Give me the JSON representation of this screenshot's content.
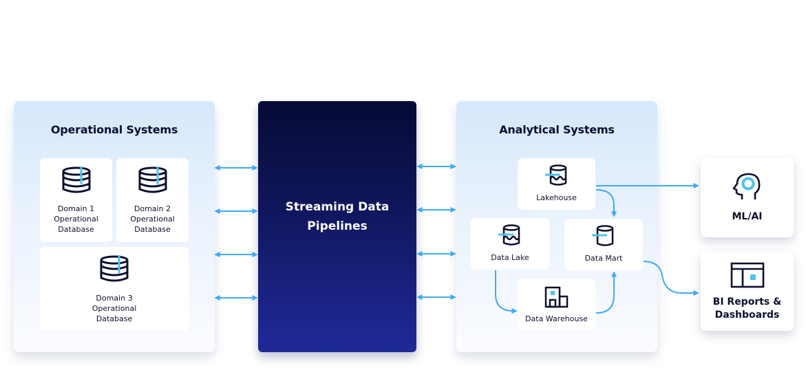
{
  "colors": {
    "accent": "#3fa9f5",
    "icon_stroke": "#0b0f2e",
    "icon_highlight": "#4dc3ee",
    "pipeline_top": "#050a35",
    "pipeline_bottom": "#1f2a9a",
    "panel_tint": "#d6e8fc"
  },
  "operational": {
    "title": "Operational Systems",
    "databases": [
      {
        "line1": "Domain 1",
        "line2": "Operational",
        "line3": "Database",
        "icon": "database-icon"
      },
      {
        "line1": "Domain 2",
        "line2": "Operational",
        "line3": "Database",
        "icon": "database-icon"
      },
      {
        "line1": "Domain 3",
        "line2": "Operational",
        "line3": "Database",
        "icon": "database-icon"
      }
    ]
  },
  "pipeline": {
    "line1": "Streaming Data",
    "line2": "Pipelines"
  },
  "analytical": {
    "title": "Analytical Systems",
    "nodes": {
      "lakehouse": {
        "label": "Lakehouse",
        "icon": "lakehouse-icon"
      },
      "data_lake": {
        "label": "Data Lake",
        "icon": "data-lake-icon"
      },
      "data_mart": {
        "label": "Data Mart",
        "icon": "data-mart-icon"
      },
      "data_warehouse": {
        "label": "Data Warehouse",
        "icon": "warehouse-building-icon"
      }
    }
  },
  "outputs": {
    "ml_ai": {
      "label": "ML/AI",
      "icon": "ai-head-icon"
    },
    "bi": {
      "line1": "BI Reports &",
      "line2": "Dashboards",
      "icon": "dashboard-icon"
    }
  },
  "connections": [
    {
      "from": "Operational Systems",
      "to": "Streaming Data Pipelines",
      "type": "bidirectional",
      "count": 4
    },
    {
      "from": "Streaming Data Pipelines",
      "to": "Analytical Systems",
      "type": "bidirectional",
      "count": 4
    },
    {
      "from": "Lakehouse",
      "to": "Data Mart",
      "type": "directed"
    },
    {
      "from": "Data Lake",
      "to": "Data Warehouse",
      "type": "directed"
    },
    {
      "from": "Data Warehouse",
      "to": "Data Mart",
      "type": "directed"
    },
    {
      "from": "Lakehouse",
      "to": "ML/AI",
      "type": "directed"
    },
    {
      "from": "Data Mart",
      "to": "BI Reports & Dashboards",
      "type": "directed"
    }
  ]
}
